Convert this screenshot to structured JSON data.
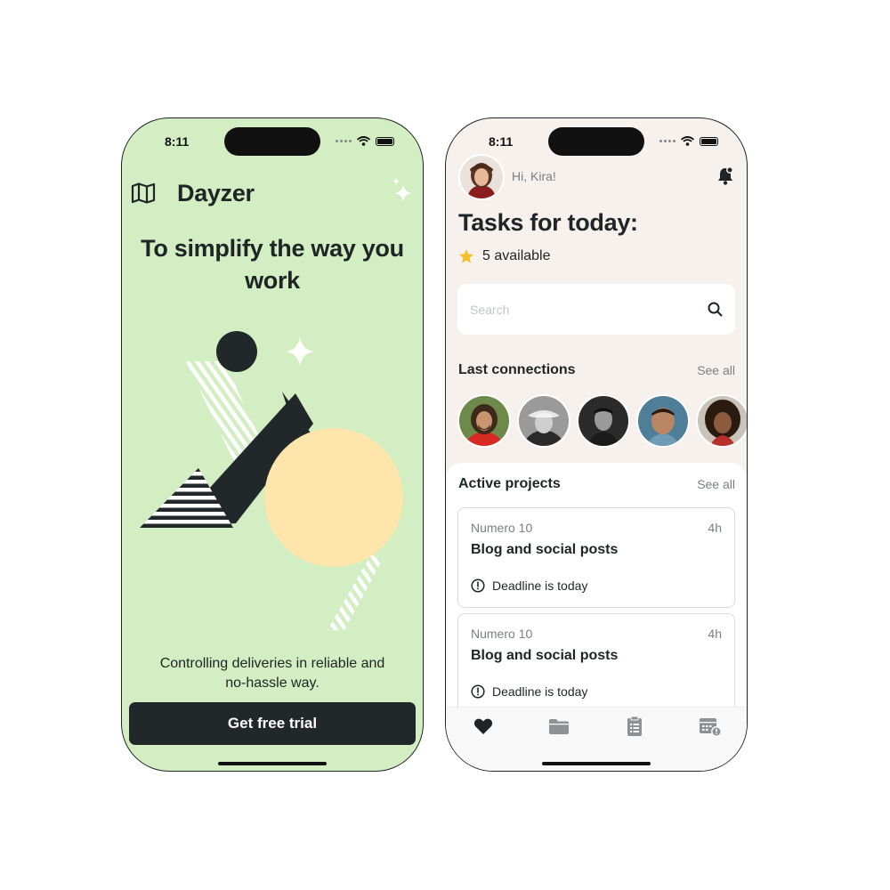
{
  "phones": {
    "left": {
      "status": {
        "time": "8:11"
      },
      "brand": {
        "name": "Dayzer",
        "icon": "map-icon",
        "decor_icon": "sparkles-icon"
      },
      "hero": {
        "title": "To simplify the way you work"
      },
      "tagline": "Controlling deliveries in reliable and no-hassle way.",
      "cta": {
        "label": "Get free trial"
      },
      "colors": {
        "background": "#d2eec2",
        "dark": "#22272a",
        "accent_circle": "#fde5ab"
      }
    },
    "right": {
      "status": {
        "time": "8:11"
      },
      "header": {
        "greeting": "Hi, Kira!",
        "notification_icon": "bell-icon"
      },
      "tasks": {
        "title": "Tasks for today:",
        "available": "5 available",
        "star_color": "#f6c02a"
      },
      "search": {
        "placeholder": "Search"
      },
      "connections": {
        "title": "Last connections",
        "see_all": "See all",
        "avatars": [
          "connection-1",
          "connection-2",
          "connection-3",
          "connection-4",
          "connection-5"
        ]
      },
      "projects": {
        "title": "Active projects",
        "see_all": "See all",
        "items": [
          {
            "subtitle": "Numero 10",
            "time": "4h",
            "title": "Blog and social posts",
            "deadline": "Deadline is today"
          },
          {
            "subtitle": "Numero 10",
            "time": "4h",
            "title": "Blog and social posts",
            "deadline": "Deadline is today"
          }
        ]
      },
      "tabs": [
        {
          "icon": "heart-icon",
          "active": true
        },
        {
          "icon": "folder-icon",
          "active": false
        },
        {
          "icon": "clipboard-icon",
          "active": false
        },
        {
          "icon": "calendar-alert-icon",
          "active": false
        }
      ],
      "colors": {
        "background": "#f7f1ee",
        "card_border": "#d8dadc"
      }
    }
  }
}
